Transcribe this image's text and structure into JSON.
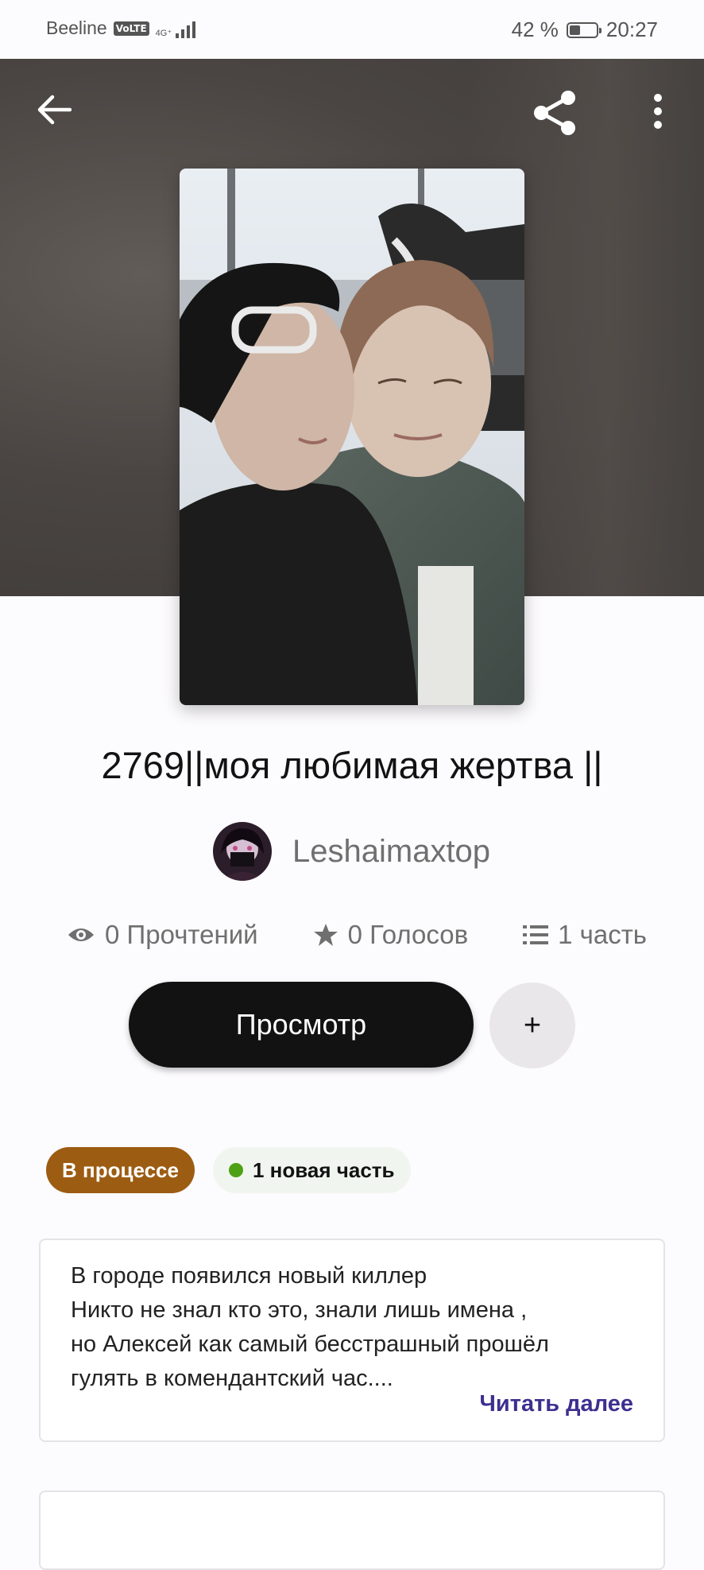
{
  "status_bar": {
    "carrier": "Beeline",
    "volte": "VoLTE",
    "network": "4G⁺",
    "battery_text": "42 %",
    "battery_level": 0.42,
    "time": "20:27"
  },
  "header": {
    "back_icon": "arrow-left-icon",
    "share_icon": "share-icon",
    "more_icon": "more-vertical-icon"
  },
  "story": {
    "title": "2769||моя любимая жертва ||",
    "author": "Leshaimaxtop",
    "stats": {
      "reads": "0 Прочтений",
      "votes": "0 Голосов",
      "parts": "1 часть"
    },
    "read_button": "Просмотр",
    "add_button": "+",
    "status_badge": "В процессе",
    "new_part_badge": "1 новая часть",
    "description": "В городе появился новый киллер\nНикто не знал кто это, знали лишь имена ,\nно Алексей как самый бесстрашный прошёл\nгулять в комендантский час....",
    "read_more": "Читать далее"
  },
  "colors": {
    "primary_button": "#121212",
    "status_badge": "#9c5c12",
    "new_dot": "#4ea115",
    "link": "#3d2f8f"
  }
}
